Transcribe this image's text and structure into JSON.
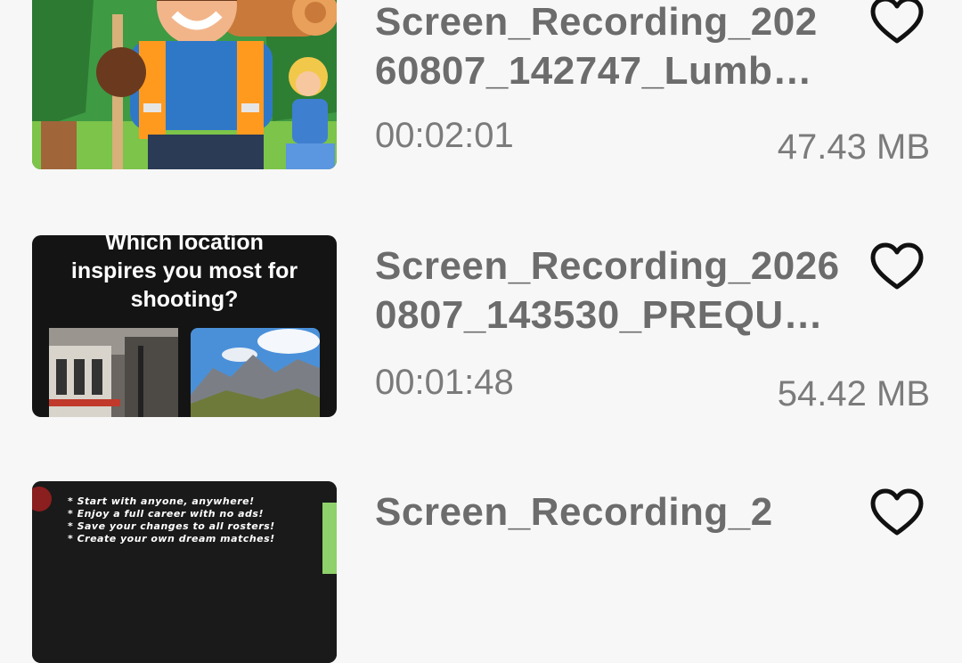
{
  "items": [
    {
      "title_line1": "Screen_Recording_202",
      "title_line2": "60807_142747_Lumb…",
      "duration": "00:02:01",
      "size": "47.43 MB",
      "thumbnail": "lumberjack-game-art"
    },
    {
      "title_line1": "Screen_Recording_2026",
      "title_line2": "0807_143530_PREQU…",
      "duration": "00:01:48",
      "size": "54.42 MB",
      "thumbnail": "photo-quiz",
      "thumb_text_line1": "Which location",
      "thumb_text_line2": "inspires you most for",
      "thumb_text_line3": "shooting?"
    },
    {
      "title_line1": "Screen_Recording_2",
      "thumbnail": "wrestling-promo",
      "promo_lines": [
        "* Start with anyone, anywhere!",
        "* Enjoy a full career with no ads!",
        "* Save your changes to all rosters!",
        "* Create your own dream matches!"
      ]
    }
  ],
  "icons": {
    "favorite": "heart-outline-icon"
  },
  "colors": {
    "background": "#f7f7f7",
    "title": "#6c6c6c",
    "meta": "#7b7b7b"
  }
}
